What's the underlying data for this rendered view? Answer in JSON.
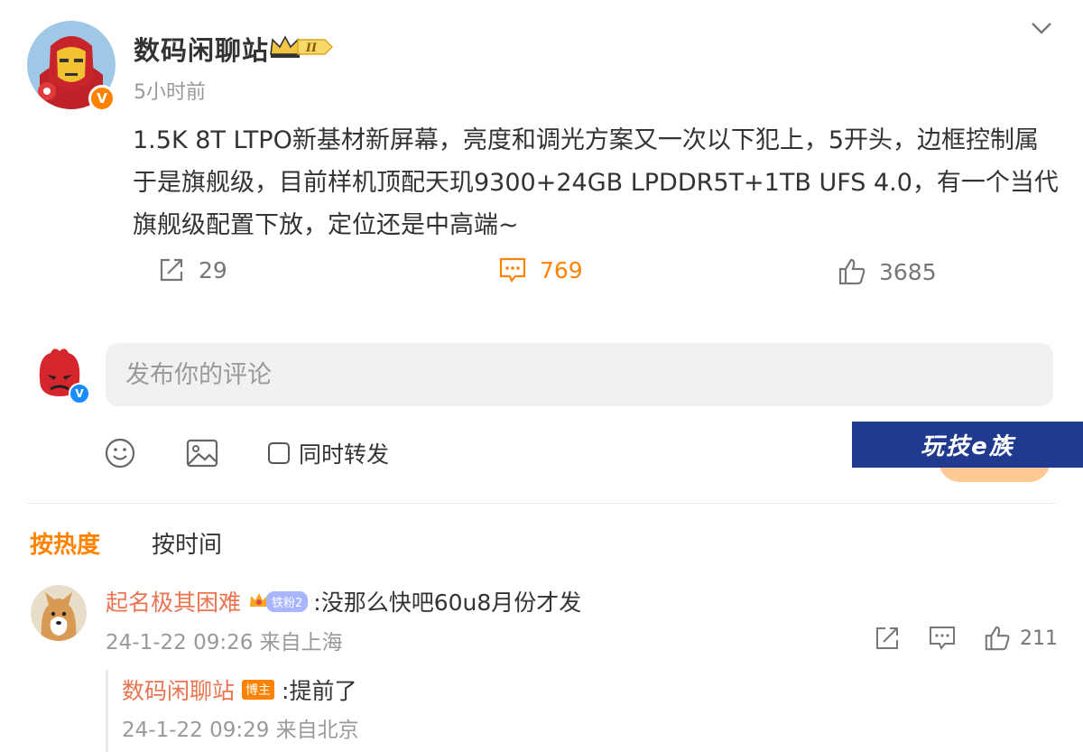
{
  "post": {
    "author": "数码闲聊站",
    "verified_badge": "V",
    "level_badge": "II",
    "time": "5小时前",
    "text": "1.5K 8T LTPO新基材新屏幕，亮度和调光方案又一次以下犯上，5开头，边框控制属于是旗舰级，目前样机顶配天玑9300+24GB LPDDR5T+1TB UFS 4.0，有一个当代旗舰级配置下放，定位还是中高端~",
    "shares": "29",
    "comments": "769",
    "likes": "3685"
  },
  "composer": {
    "verified_badge": "V",
    "placeholder": "发布你的评论",
    "repost_label": "同时转发",
    "watermark": "玩技e族"
  },
  "sort": {
    "hot": "按热度",
    "time": "按时间"
  },
  "comments": [
    {
      "name": "起名极其困难",
      "fan_badge": "铁粉2",
      "text": ":没那么快吧60u8月份才发",
      "meta": "24-1-22 09:26 来自上海",
      "likes": "211",
      "reply": {
        "name": "数码闲聊站",
        "badge": "博主",
        "text": ":提前了",
        "meta": "24-1-22 09:29 来自北京"
      }
    }
  ],
  "colors": {
    "accent": "#ff8200",
    "username": "#eb7350",
    "muted": "#999999",
    "watermark_bg": "#1f3a8f"
  }
}
